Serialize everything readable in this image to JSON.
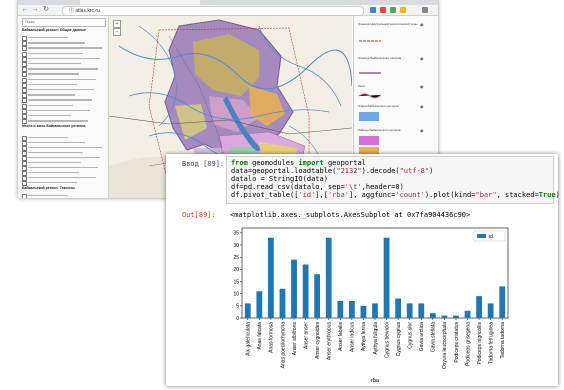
{
  "browser": {
    "url": "ⓘ atlas.krc.ru",
    "left_panel": {
      "search_placeholder": "Поиск",
      "section1_title": "Байкальский регион: Общие данные",
      "section2_title": "Места и зоны Байкальского региона",
      "section3_title": "Байкальский регион: Таксоны"
    },
    "legend": {
      "items": [
        "Граница Центральной экологической зоны",
        "Граница Байкальского региона",
        "Реки",
        "Озёра Байкальского региона",
        "Районы Байкальского региона"
      ]
    }
  },
  "notebook": {
    "in_prompt": "Ввод [89]:",
    "out_prompt": "Out[89]:",
    "code": {
      "l1_kw1": "from",
      "l1_mod": " geomodules ",
      "l1_kw2": "import",
      "l1_name": " geoportal",
      "l2_a": "data=geoportal.loadtable(",
      "l2_s1": "\"2132\"",
      "l2_b": ").decode(",
      "l2_s2": "\"utf-8\"",
      "l2_c": ")",
      "l3": "datalo = StringIO(data)",
      "l4_a": "df=pd.read_csv(datalo, sep=",
      "l4_s": "'\\t'",
      "l4_b": ",header=0)",
      "l5_a": "df.pivot_table([",
      "l5_s1": "'id'",
      "l5_b": "],[",
      "l5_s2": "'rba'",
      "l5_c": "], aggfunc=",
      "l5_s3": "'count'",
      "l5_d": ").plot(kind=",
      "l5_s4": "\"bar\"",
      "l5_e": ", stacked=",
      "l5_kw": "True",
      "l5_f": ")"
    },
    "output_text": "<matplotlib.axes._subplots.AxesSubplot at 0x7fa904436c90>"
  },
  "chart_data": {
    "type": "bar",
    "categories": [
      "Aix galericulata",
      "Anas falcata",
      "Anas formosa",
      "Anas poecilorhyncha",
      "Anser albifrons",
      "Anser anser",
      "Anser cygnoides",
      "Anser erythropus",
      "Anser fabalis",
      "Anser indicus",
      "Aythya ferina",
      "Aythya fuligula",
      "Cygnus bewickii",
      "Cygnus cygnus",
      "Cygnus olor",
      "Gavia arctica",
      "Gavia stellata",
      "Oxyura leucocephala",
      "Podiceps cristatus",
      "Podiceps grisegena",
      "Podiceps nigricollis",
      "Tadorna ferruginea",
      "Tadorna tadorna"
    ],
    "series": [
      {
        "name": "id",
        "values": [
          6,
          11,
          33,
          12,
          24,
          22,
          18,
          33,
          7,
          7,
          5,
          6,
          33,
          8,
          6,
          6,
          2,
          1,
          1,
          3,
          9,
          6,
          13
        ]
      }
    ],
    "ylim": [
      0,
      37
    ],
    "yticks": [
      0,
      5,
      10,
      15,
      20,
      25,
      30,
      35
    ],
    "xlabel": "rba",
    "legend_position": "top-right",
    "bar_color": "#1f77b4"
  }
}
